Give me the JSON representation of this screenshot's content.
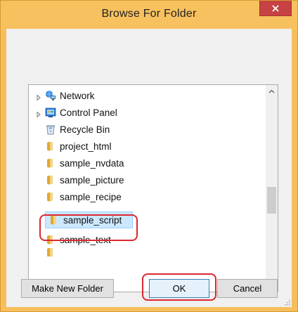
{
  "window": {
    "title": "Browse For Folder"
  },
  "tree": {
    "items": [
      {
        "label": "Network",
        "icon": "network-icon",
        "expandable": true
      },
      {
        "label": "Control Panel",
        "icon": "control-panel-icon",
        "expandable": true
      },
      {
        "label": "Recycle Bin",
        "icon": "recycle-bin-icon",
        "expandable": false
      },
      {
        "label": "project_html",
        "icon": "folder-icon",
        "expandable": false
      },
      {
        "label": "sample_nvdata",
        "icon": "folder-icon",
        "expandable": false
      },
      {
        "label": "sample_picture",
        "icon": "folder-icon",
        "expandable": false
      },
      {
        "label": "sample_recipe",
        "icon": "folder-icon",
        "expandable": false
      },
      {
        "label": "sample_script",
        "icon": "folder-icon",
        "expandable": false,
        "selected": true
      },
      {
        "label": "sample_text",
        "icon": "folder-icon",
        "expandable": false
      }
    ]
  },
  "buttons": {
    "make_new_folder": "Make New Folder",
    "ok": "OK",
    "cancel": "Cancel"
  },
  "colors": {
    "title_bar": "#f7c15f",
    "close_button": "#c74343",
    "selection": "#cce8ff",
    "highlight_ring": "#d9282f",
    "folder": "#e8b53a"
  }
}
